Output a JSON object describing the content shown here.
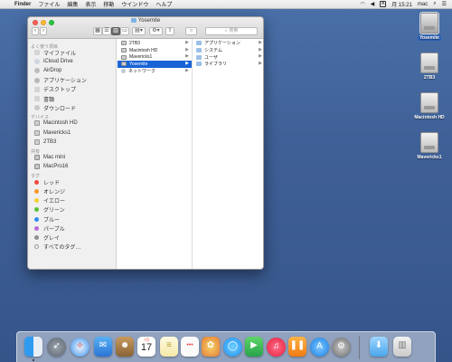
{
  "menubar": {
    "app_name": "Finder",
    "menus": [
      "ファイル",
      "編集",
      "表示",
      "移動",
      "ウインドウ",
      "ヘルプ"
    ],
    "input_badge": "A",
    "clock": "月 15:21",
    "user": "mac"
  },
  "window": {
    "title": "Yosemite",
    "search_placeholder": "検索"
  },
  "sidebar": {
    "favorites_header": "よく使う項目",
    "favorites": [
      {
        "label": "マイファイル",
        "icon": "all-files-icon"
      },
      {
        "label": "iCloud Drive",
        "icon": "cloud-icon"
      },
      {
        "label": "AirDrop",
        "icon": "airdrop-icon"
      },
      {
        "label": "アプリケーション",
        "icon": "applications-icon"
      },
      {
        "label": "デスクトップ",
        "icon": "desktop-icon"
      },
      {
        "label": "書類",
        "icon": "documents-icon"
      },
      {
        "label": "ダウンロード",
        "icon": "downloads-icon"
      }
    ],
    "devices_header": "デバイス",
    "devices": [
      {
        "label": "Macintosh HD",
        "icon": "hard-disk-icon"
      },
      {
        "label": "Mavericks1",
        "icon": "hard-disk-icon"
      },
      {
        "label": "2TB3",
        "icon": "hard-disk-icon"
      }
    ],
    "shared_header": "共有",
    "shared": [
      {
        "label": "Mac mini",
        "icon": "computer-icon"
      },
      {
        "label": "MacPro16",
        "icon": "computer-icon"
      }
    ],
    "tags_header": "タグ",
    "tags": [
      {
        "label": "レッド",
        "color": "#f0473f"
      },
      {
        "label": "オレンジ",
        "color": "#f59a2c"
      },
      {
        "label": "イエロー",
        "color": "#f3d232"
      },
      {
        "label": "グリーン",
        "color": "#5bc236"
      },
      {
        "label": "ブルー",
        "color": "#2d8df4"
      },
      {
        "label": "パープル",
        "color": "#b86ad8"
      },
      {
        "label": "グレイ",
        "color": "#8f8f8f"
      },
      {
        "label": "すべてのタグ…",
        "color": ""
      }
    ]
  },
  "columns": {
    "col1": [
      {
        "label": "2TB3",
        "icon": "hard-disk-icon",
        "selected": false
      },
      {
        "label": "Macintosh HD",
        "icon": "hard-disk-icon",
        "selected": false
      },
      {
        "label": "Mavericks1",
        "icon": "hard-disk-icon",
        "selected": false
      },
      {
        "label": "Yosemite",
        "icon": "hard-disk-icon",
        "selected": true
      },
      {
        "label": "ネットワーク",
        "icon": "network-icon",
        "selected": false
      }
    ],
    "col2": [
      {
        "label": "アプリケーション",
        "icon": "folder-icon"
      },
      {
        "label": "システム",
        "icon": "folder-icon"
      },
      {
        "label": "ユーザ",
        "icon": "folder-icon"
      },
      {
        "label": "ライブラリ",
        "icon": "folder-icon"
      }
    ]
  },
  "desktop_icons": [
    {
      "label": "Yosemite",
      "selected": true
    },
    {
      "label": "2TB3",
      "selected": false
    },
    {
      "label": "Macintosh HD",
      "selected": false
    },
    {
      "label": "Mavericks1",
      "selected": false
    }
  ],
  "dock": {
    "calendar_month": "7月",
    "calendar_day": "17",
    "appstore_badge": "1"
  }
}
